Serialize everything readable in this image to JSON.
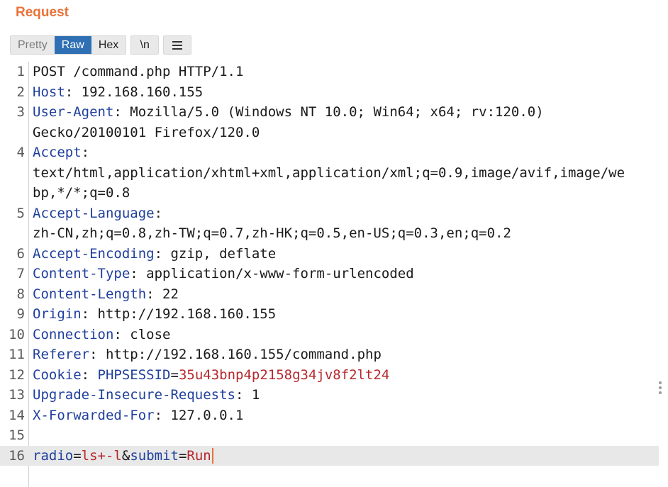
{
  "panel": {
    "title": "Request"
  },
  "toolbar": {
    "tabs": [
      "Pretty",
      "Raw",
      "Hex"
    ],
    "active_tab": "Raw",
    "newline_label": "\\n",
    "menu_icon": "hamburger-menu-icon"
  },
  "editor": {
    "line1": {
      "num": "1",
      "text": "POST /command.php HTTP/1.1"
    },
    "line2": {
      "num": "2",
      "name": "Host",
      "value": ": 192.168.160.155"
    },
    "line3": {
      "num": "3",
      "name": "User-Agent",
      "value": ": Mozilla/5.0 (Windows NT 10.0; Win64; x64; rv:120.0)",
      "cont": "Gecko/20100101 Firefox/120.0"
    },
    "line4": {
      "num": "4",
      "name": "Accept",
      "value": ":",
      "cont1": "text/html,application/xhtml+xml,application/xml;q=0.9,image/avif,image/we",
      "cont2": "bp,*/*;q=0.8"
    },
    "line5": {
      "num": "5",
      "name": "Accept-Language",
      "value": ":",
      "cont": "zh-CN,zh;q=0.8,zh-TW;q=0.7,zh-HK;q=0.5,en-US;q=0.3,en;q=0.2"
    },
    "line6": {
      "num": "6",
      "name": "Accept-Encoding",
      "value": ": gzip, deflate"
    },
    "line7": {
      "num": "7",
      "name": "Content-Type",
      "value": ": application/x-www-form-urlencoded"
    },
    "line8": {
      "num": "8",
      "name": "Content-Length",
      "value": ": 22"
    },
    "line9": {
      "num": "9",
      "name": "Origin",
      "value": ": http://192.168.160.155"
    },
    "line10": {
      "num": "10",
      "name": "Connection",
      "value": ": close"
    },
    "line11": {
      "num": "11",
      "name": "Referer",
      "value": ": http://192.168.160.155/command.php"
    },
    "line12": {
      "num": "12",
      "name": "Cookie",
      "sep": ": ",
      "cookie_name": "PHPSESSID",
      "eq": "=",
      "cookie_value": "35u43bnp4p2158g34jv8f2lt24"
    },
    "line13": {
      "num": "13",
      "name": "Upgrade-Insecure-Requests",
      "value": ": 1"
    },
    "line14": {
      "num": "14",
      "name": "X-Forwarded-For",
      "value": ": 127.0.0.1"
    },
    "line15": {
      "num": "15"
    },
    "line16": {
      "num": "16",
      "p1": "radio",
      "eq1": "=",
      "v1": "ls+-l",
      "amp": "&",
      "p2": "submit",
      "eq2": "=",
      "v2": "Run"
    }
  },
  "colors": {
    "title": "#e8733a",
    "active_tab": "#2f6fb3",
    "header_name": "#1f3f9c",
    "param_value": "#b5272d"
  }
}
